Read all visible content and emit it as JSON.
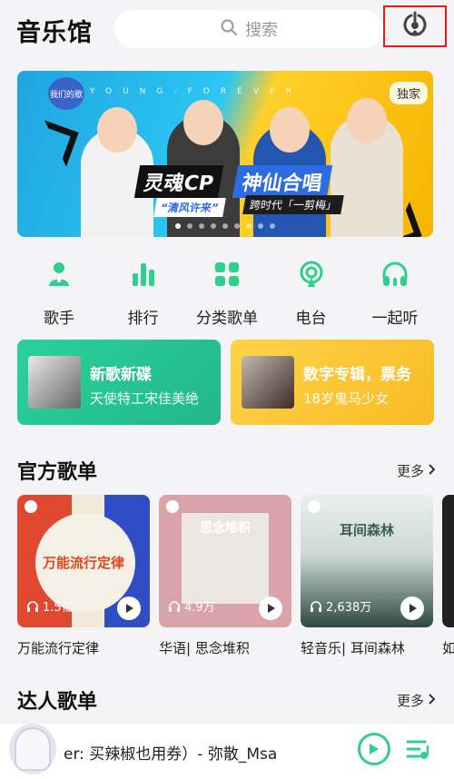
{
  "header": {
    "title": "音乐馆",
    "search_placeholder": "搜索"
  },
  "banner": {
    "badge": "独家",
    "topline": "YOUNG-FOREVER",
    "logo_text": "我们的歌",
    "caption_left": "灵魂CP",
    "caption_right": "神仙合唱",
    "sub_left": "“清风许来”",
    "sub_right": "跨时代「一剪梅」",
    "slide_count": 9,
    "active_slide": 0
  },
  "categories": [
    {
      "label": "歌手",
      "icon": "singer-icon"
    },
    {
      "label": "排行",
      "icon": "chart-icon"
    },
    {
      "label": "分类歌单",
      "icon": "category-icon"
    },
    {
      "label": "电台",
      "icon": "radio-icon"
    },
    {
      "label": "一起听",
      "icon": "listen-together-icon"
    }
  ],
  "promos": [
    {
      "title": "新歌新碟",
      "subtitle": "天使特工宋佳美绝"
    },
    {
      "title": "数字专辑，票务",
      "subtitle": "18岁鬼马少女"
    }
  ],
  "official": {
    "heading": "官方歌单",
    "more": "更多",
    "playlists": [
      {
        "name": "万能流行定律",
        "count": "1.5亿",
        "cover_title": "万能流行定律"
      },
      {
        "name": "华语| 思念堆积",
        "count": "4.9万",
        "cover_title": "思念堆积"
      },
      {
        "name": "轻音乐| 耳间森林",
        "count": "2,638万",
        "cover_title": "耳间森林"
      },
      {
        "name": "如",
        "count": "",
        "cover_title": ""
      }
    ]
  },
  "experts": {
    "heading": "达人歌单",
    "more": "更多"
  },
  "player": {
    "song": "er: 买辣椒也用券）- 弥散_Msa"
  },
  "colors": {
    "accent": "#2fd08d",
    "highlight_border": "#e0201a"
  }
}
